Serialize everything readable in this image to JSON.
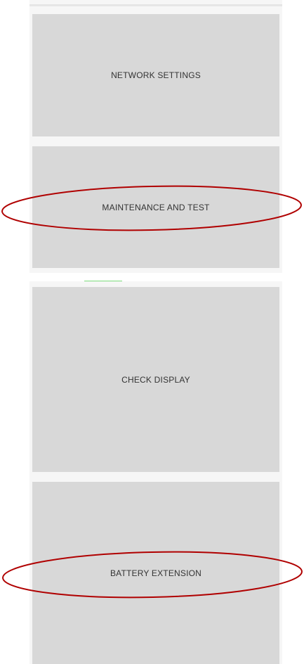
{
  "menu": {
    "items": [
      {
        "label": "NETWORK SETTINGS"
      },
      {
        "label": "MAINTENANCE AND TEST"
      },
      {
        "label": "CHECK DISPLAY"
      },
      {
        "label": "BATTERY EXTENSION"
      }
    ]
  },
  "colors": {
    "tile_background": "#d8d8d8",
    "panel_background": "#f6f6f6",
    "annotation_ellipse": "#b00000",
    "indicator": "#7cdc7c"
  }
}
